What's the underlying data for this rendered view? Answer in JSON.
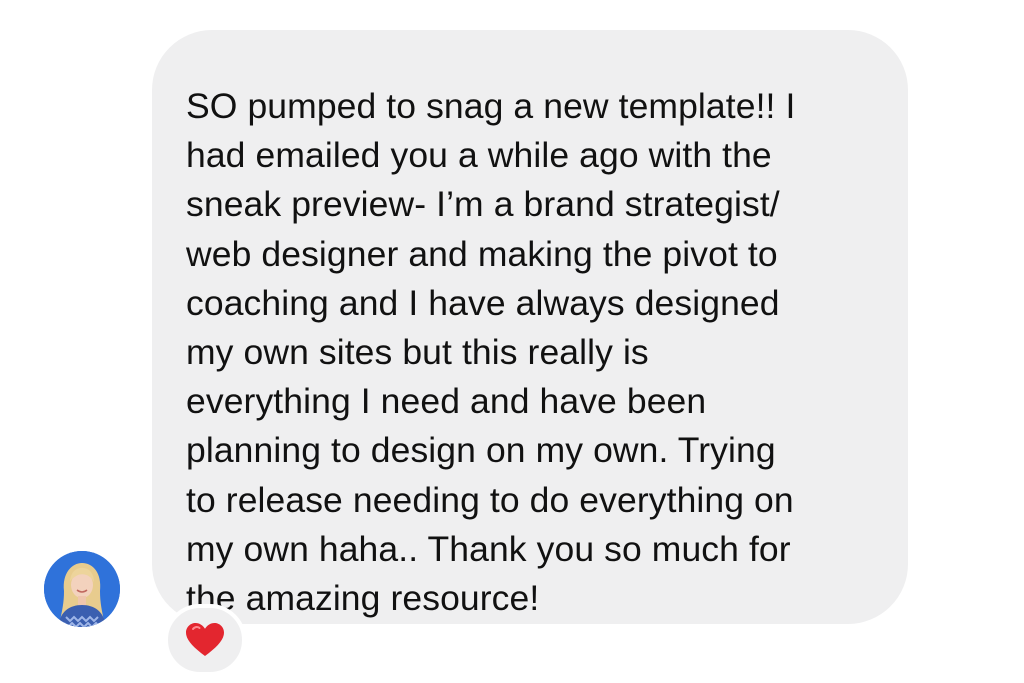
{
  "message": {
    "lines": [
      "SO pumped to snag a new template!! I",
      "had emailed you a while ago with the",
      "sneak preview- I’m a brand strategist/",
      "web designer and making the pivot to",
      "coaching and I have always designed",
      "my own sites but this really is",
      "everything I need and have been",
      "planning to design on my own. Trying",
      "to release needing to do everything on",
      "my own haha.. Thank you so much for",
      "the amazing resource!"
    ]
  },
  "reaction": {
    "emoji_name": "red-heart",
    "color": "#e3262f"
  },
  "avatar": {
    "background": "#2e6fd8"
  },
  "theme": {
    "bubble_color": "#efeff0",
    "text_color": "#111111"
  }
}
